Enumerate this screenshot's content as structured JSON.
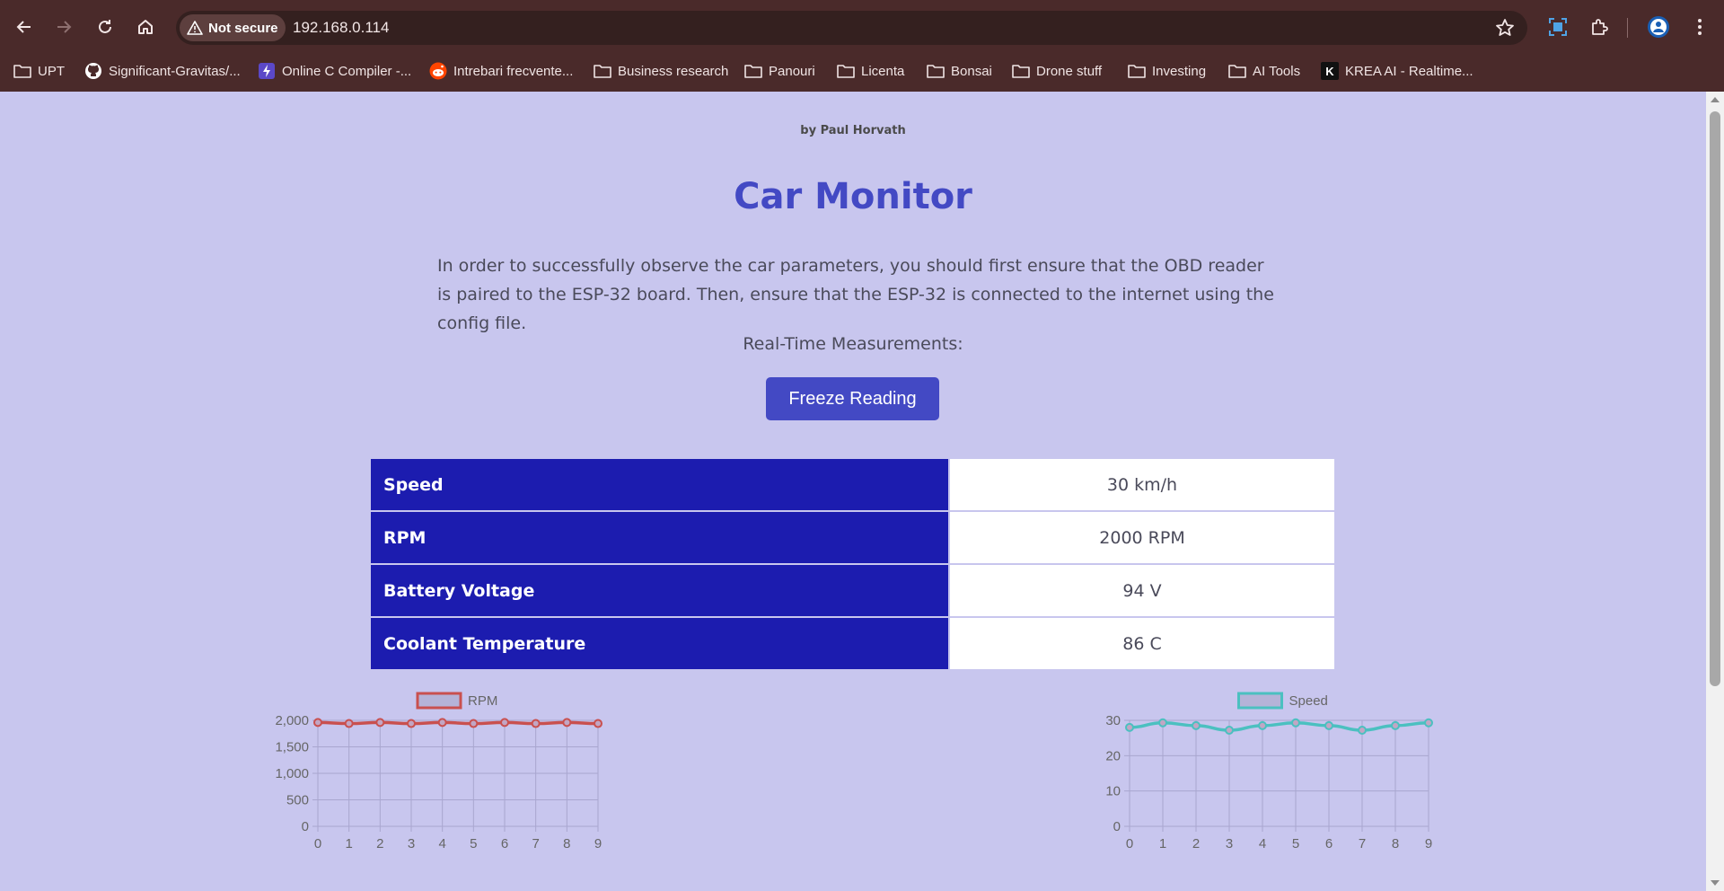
{
  "browser": {
    "security_label": "Not secure",
    "url": "192.168.0.114",
    "bookmarks": [
      {
        "label": "UPT",
        "icon": "folder-icon"
      },
      {
        "label": "Significant-Gravitas/...",
        "icon": "github-icon"
      },
      {
        "label": "Online C Compiler -...",
        "icon": "bolt-icon"
      },
      {
        "label": "Intrebari frecvente...",
        "icon": "reddit-icon"
      },
      {
        "label": "Business research",
        "icon": "folder-icon"
      },
      {
        "label": "Panouri",
        "icon": "folder-icon"
      },
      {
        "label": "Licenta",
        "icon": "folder-icon"
      },
      {
        "label": "Bonsai",
        "icon": "folder-icon"
      },
      {
        "label": "Drone stuff",
        "icon": "folder-icon"
      },
      {
        "label": "Investing",
        "icon": "folder-icon"
      },
      {
        "label": "AI Tools",
        "icon": "folder-icon"
      },
      {
        "label": "KREA AI - Realtime...",
        "icon": "krea-icon"
      }
    ],
    "krea_letter": "K"
  },
  "page": {
    "byline": "by Paul Horvath",
    "title": "Car Monitor",
    "intro": "In order to successfully observe the car parameters, you should first ensure that the OBD reader is paired to the ESP-32 board. Then, ensure that the ESP-32 is connected to the internet using the config file.",
    "realtime_label": "Real-Time Measurements:",
    "freeze_button": "Freeze Reading",
    "measurements": [
      {
        "label": "Speed",
        "value": "30 km/h"
      },
      {
        "label": "RPM",
        "value": "2000 RPM"
      },
      {
        "label": "Battery Voltage",
        "value": "94 V"
      },
      {
        "label": "Coolant Temperature",
        "value": "86 C"
      }
    ]
  },
  "colors": {
    "page_bg": "#c8c6ee",
    "accent": "#4349c4",
    "table_header": "#1c1caf",
    "rpm_line": "#c9504f",
    "speed_line": "#4bc0c0"
  },
  "chart_data": [
    {
      "type": "line",
      "series": [
        {
          "name": "RPM",
          "values": [
            1960,
            1940,
            1960,
            1940,
            1960,
            1940,
            1960,
            1940,
            1960,
            1940
          ]
        }
      ],
      "x": [
        0,
        1,
        2,
        3,
        4,
        5,
        6,
        7,
        8,
        9
      ],
      "ylim": [
        0,
        2000
      ],
      "yticks": [
        "0",
        "500",
        "1,000",
        "1,500",
        "2,000"
      ],
      "xticks": [
        "0",
        "1",
        "2",
        "3",
        "4",
        "5",
        "6",
        "7",
        "8",
        "9"
      ],
      "color": "#c9504f",
      "grid": true,
      "legend": "top"
    },
    {
      "type": "line",
      "series": [
        {
          "name": "Speed",
          "values": [
            28,
            29.3,
            28.5,
            27.2,
            28.5,
            29.3,
            28.5,
            27.2,
            28.5,
            29.3
          ]
        }
      ],
      "x": [
        0,
        1,
        2,
        3,
        4,
        5,
        6,
        7,
        8,
        9
      ],
      "ylim": [
        0,
        30
      ],
      "yticks": [
        "0",
        "10",
        "20",
        "30"
      ],
      "xticks": [
        "0",
        "1",
        "2",
        "3",
        "4",
        "5",
        "6",
        "7",
        "8",
        "9"
      ],
      "color": "#4bc0c0",
      "grid": true,
      "legend": "top"
    }
  ]
}
